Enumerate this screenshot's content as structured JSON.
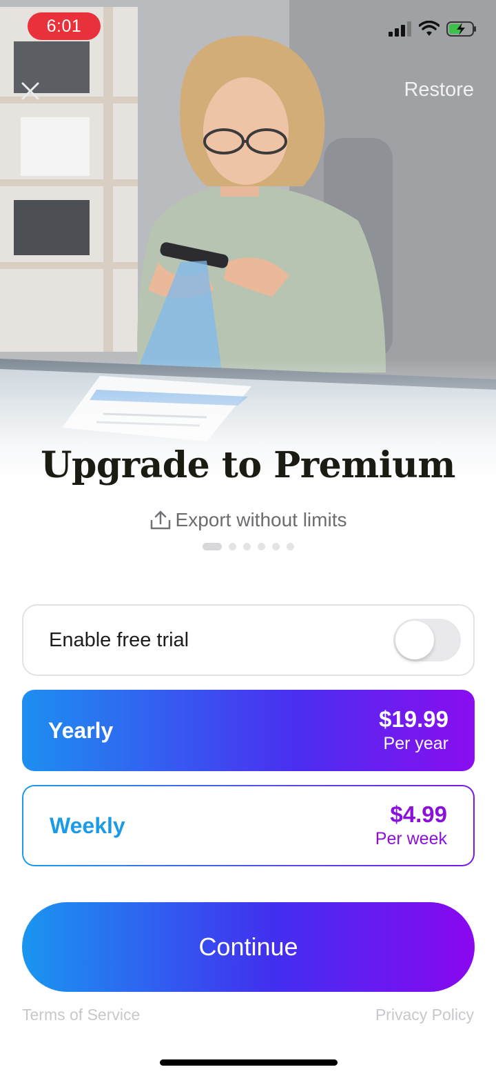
{
  "status_bar": {
    "time": "6:01"
  },
  "header": {
    "restore_label": "Restore"
  },
  "hero": {
    "title": "Upgrade to Premium",
    "feature": "Export without limits",
    "page_count": 6,
    "active_page": 1
  },
  "trial": {
    "label": "Enable free trial",
    "enabled": false
  },
  "plans": [
    {
      "name": "Yearly",
      "price": "$19.99",
      "period": "Per year",
      "selected": true
    },
    {
      "name": "Weekly",
      "price": "$4.99",
      "period": "Per week",
      "selected": false
    }
  ],
  "cta": {
    "label": "Continue"
  },
  "footer": {
    "terms": "Terms of Service",
    "privacy": "Privacy Policy"
  },
  "colors": {
    "gradient_start": "#1d8ff0",
    "gradient_end": "#8a0df0",
    "time_pill": "#e8313a"
  },
  "icons": [
    "cellular-signal-icon",
    "wifi-icon",
    "battery-charging-icon",
    "close-icon",
    "share-upload-icon"
  ]
}
